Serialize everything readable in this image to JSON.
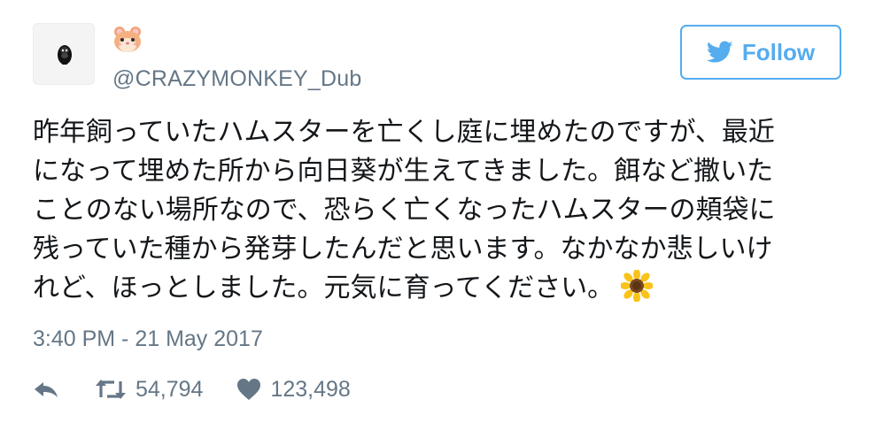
{
  "user": {
    "name_icon": "hamster-emoji",
    "handle": "@CRAZYMONKEY_Dub",
    "avatar_icon": "gorilla-avatar-icon"
  },
  "follow_button": {
    "label": "Follow",
    "icon": "twitter-bird-icon",
    "color": "#55acee"
  },
  "tweet": {
    "lines": [
      "昨年飼っていたハムスターを亡くし庭に埋めたのですが、最近",
      "になって埋めた所から向日葵が生えてきました。餌など撒いた",
      "ことのない場所なので、恐らく亡くなったハムスターの頬袋に",
      "残っていた種から発芽したんだと思います。なかなか悲しいけ",
      "れど、ほっとしました。元気に育ってください。"
    ],
    "trailing_emoji": "sunflower-emoji",
    "timestamp": "3:40 PM - 21 May 2017"
  },
  "actions": {
    "reply_icon": "reply-icon",
    "retweet_icon": "retweet-icon",
    "retweet_count": "54,794",
    "like_icon": "heart-icon",
    "like_count": "123,498",
    "icon_color": "#657786"
  }
}
